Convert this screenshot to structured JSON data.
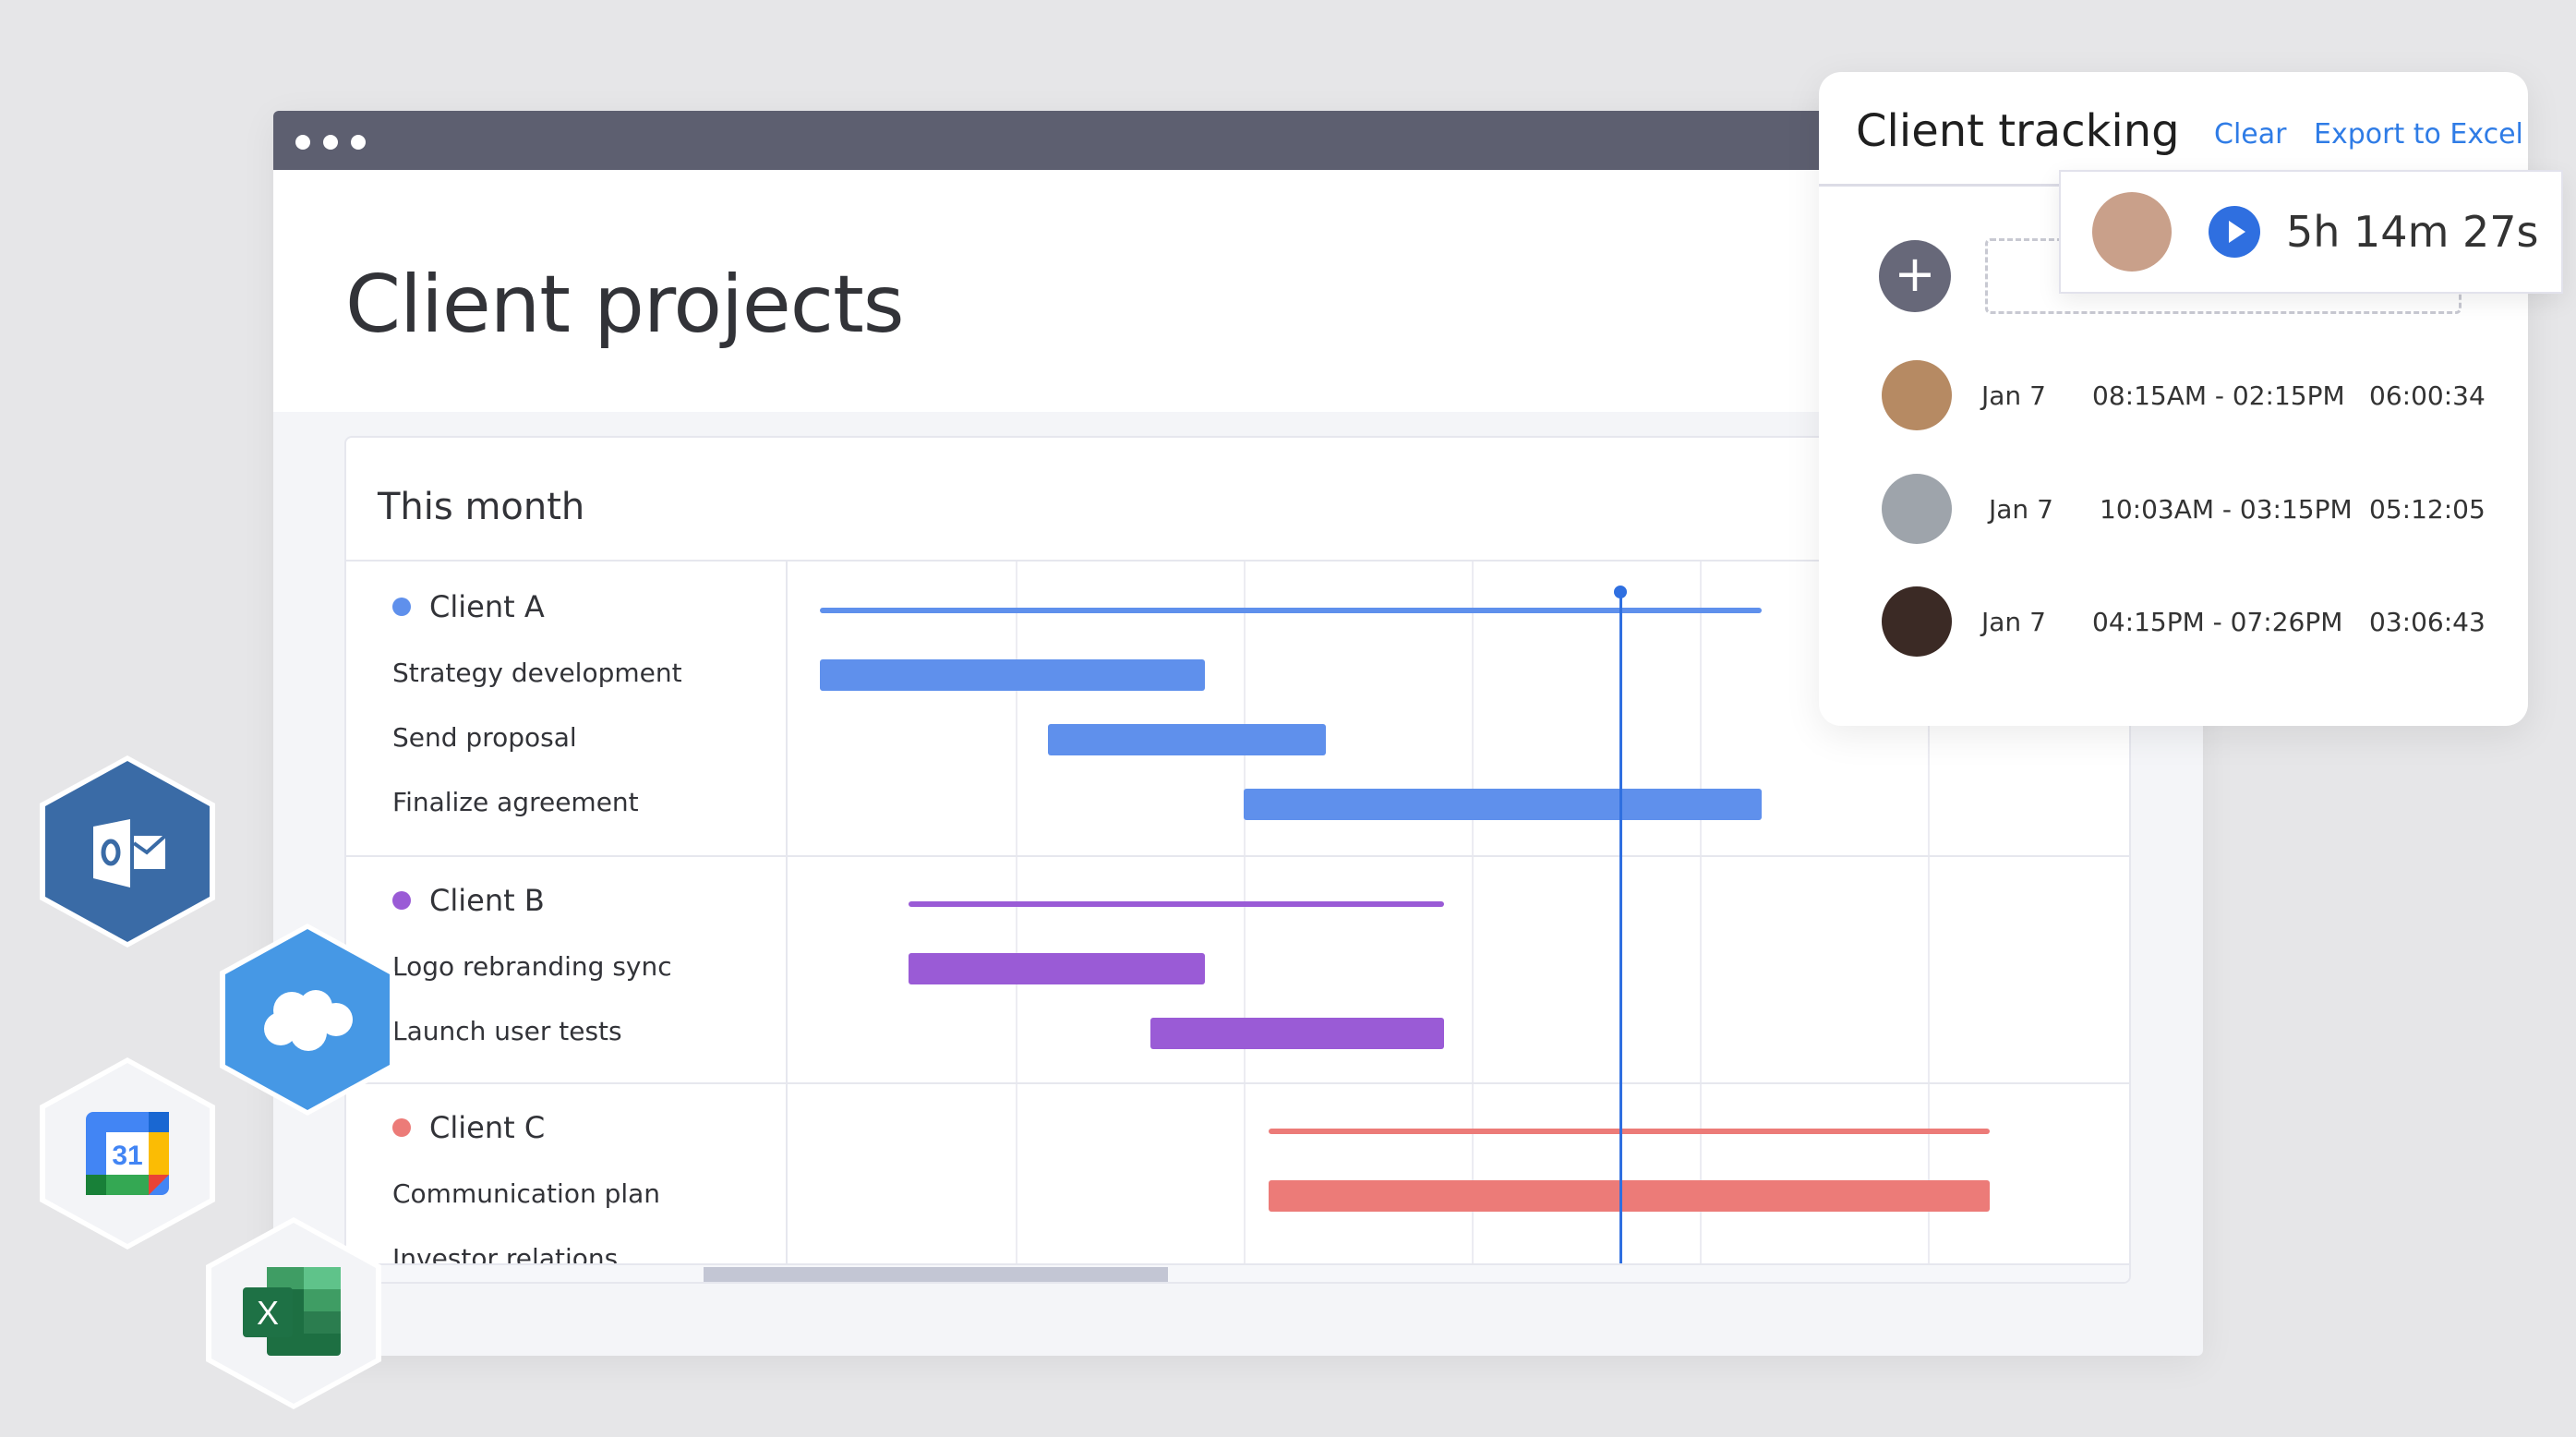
{
  "window": {
    "title_dots": 3
  },
  "page": {
    "title": "Client projects"
  },
  "timeline_card": {
    "title": "This month",
    "columns": 6,
    "today_position": 3.65,
    "scrollbar": {
      "thumb_start_fraction": 0.2,
      "thumb_length_fraction": 0.26
    },
    "groups": [
      {
        "name": "Client A",
        "color": "#5f90ec",
        "summary": {
          "start": 0.14,
          "end": 4.27
        },
        "tasks": [
          {
            "name": "Strategy development",
            "start": 0.14,
            "end": 1.83
          },
          {
            "name": "Send proposal",
            "start": 1.14,
            "end": 2.36
          },
          {
            "name": "Finalize agreement",
            "start": 2.0,
            "end": 4.27
          }
        ]
      },
      {
        "name": "Client B",
        "color": "#9a5bd6",
        "summary": {
          "start": 0.53,
          "end": 2.88
        },
        "tasks": [
          {
            "name": "Logo rebranding sync",
            "start": 0.53,
            "end": 1.83
          },
          {
            "name": "Launch user tests",
            "start": 1.59,
            "end": 2.88
          }
        ]
      },
      {
        "name": "Client C",
        "color": "#ec7b78",
        "summary": {
          "start": 2.11,
          "end": 5.27
        },
        "tasks": [
          {
            "name": "Communication plan",
            "start": 2.11,
            "end": 5.27
          },
          {
            "name": "Investor relations",
            "start": null,
            "end": null
          }
        ]
      }
    ]
  },
  "tracking_panel": {
    "title": "Client tracking",
    "clear_label": "Clear",
    "export_label": "Export to Excel",
    "add_icon": "+",
    "active_timer": {
      "value": "5h 14m 27s",
      "avatar_color": "#c9a08a"
    },
    "entries": [
      {
        "date": "Jan 7",
        "range": "08:15AM - 02:15PM",
        "duration": "06:00:34",
        "avatar_color": "#b68a63"
      },
      {
        "date": "Jan 7",
        "range": "10:03AM - 03:15PM",
        "duration": "05:12:05",
        "avatar_color": "#9ea4ab"
      },
      {
        "date": "Jan 7",
        "range": "04:15PM - 07:26PM",
        "duration": "03:06:43",
        "avatar_color": "#3b2a25"
      }
    ]
  },
  "integrations": [
    {
      "name": "Outlook",
      "glyph": "O"
    },
    {
      "name": "Salesforce",
      "glyph": "cloud"
    },
    {
      "name": "Google Calendar",
      "glyph": "31"
    },
    {
      "name": "Excel",
      "glyph": "X"
    }
  ]
}
